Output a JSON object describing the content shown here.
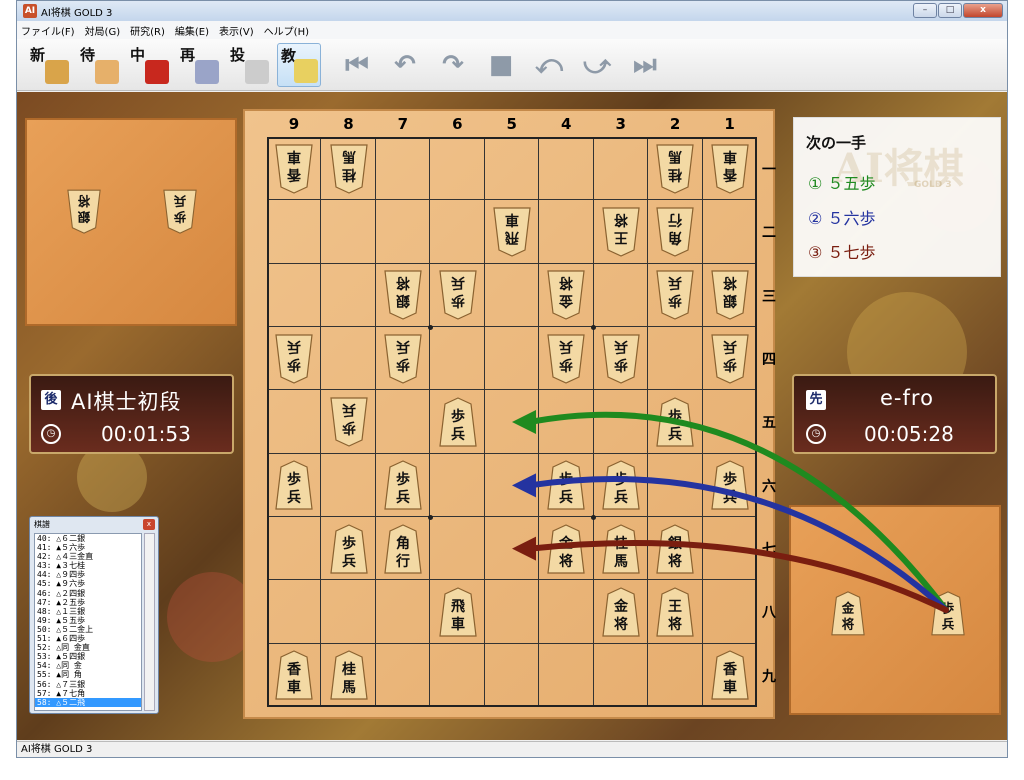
{
  "window": {
    "title": "AI将棋 GOLD 3",
    "app_icon": "AI",
    "minimize": "–",
    "maximize": "□",
    "close": "x"
  },
  "menu": [
    "ファイル(F)",
    "対局(G)",
    "研究(R)",
    "編集(E)",
    "表示(V)",
    "ヘルプ(H)"
  ],
  "toolbar": [
    {
      "label": "新",
      "icon": "new-game-icon",
      "color": "#d9a44a"
    },
    {
      "label": "待",
      "icon": "wait-hand-icon",
      "color": "#e6b06a"
    },
    {
      "label": "中",
      "icon": "stop-icon",
      "color": "#c8281e"
    },
    {
      "label": "再",
      "icon": "resume-icon",
      "color": "#9aa4c8"
    },
    {
      "label": "投",
      "icon": "resign-flag-icon",
      "color": "#cccccc"
    },
    {
      "label": "教",
      "icon": "teach-bulb-icon",
      "color": "#e8d060"
    }
  ],
  "nav_icons": [
    "first-move-icon",
    "undo-icon",
    "redo-icon",
    "stop-square-icon",
    "back-step-icon",
    "forward-step-icon",
    "last-move-icon"
  ],
  "nav_glyphs": [
    "⏮",
    "↶",
    "↷",
    "■",
    "⤺",
    "⤻",
    "⏭"
  ],
  "board": {
    "files": [
      "9",
      "8",
      "7",
      "6",
      "5",
      "4",
      "3",
      "2",
      "1"
    ],
    "ranks": [
      "一",
      "二",
      "三",
      "四",
      "五",
      "六",
      "七",
      "八",
      "九"
    ],
    "pieces": [
      {
        "file": 9,
        "rank": 1,
        "text": "香車",
        "side": "gote"
      },
      {
        "file": 8,
        "rank": 1,
        "text": "桂馬",
        "side": "gote"
      },
      {
        "file": 2,
        "rank": 1,
        "text": "桂馬",
        "side": "gote"
      },
      {
        "file": 1,
        "rank": 1,
        "text": "香車",
        "side": "gote"
      },
      {
        "file": 5,
        "rank": 2,
        "text": "飛車",
        "side": "gote"
      },
      {
        "file": 3,
        "rank": 2,
        "text": "王将",
        "side": "gote"
      },
      {
        "file": 2,
        "rank": 2,
        "text": "角行",
        "side": "gote"
      },
      {
        "file": 7,
        "rank": 3,
        "text": "銀将",
        "side": "gote"
      },
      {
        "file": 6,
        "rank": 3,
        "text": "歩兵",
        "side": "gote"
      },
      {
        "file": 4,
        "rank": 3,
        "text": "金将",
        "side": "gote"
      },
      {
        "file": 2,
        "rank": 3,
        "text": "歩兵",
        "side": "gote"
      },
      {
        "file": 1,
        "rank": 3,
        "text": "銀将",
        "side": "gote"
      },
      {
        "file": 9,
        "rank": 4,
        "text": "歩兵",
        "side": "gote"
      },
      {
        "file": 7,
        "rank": 4,
        "text": "歩兵",
        "side": "gote"
      },
      {
        "file": 4,
        "rank": 4,
        "text": "歩兵",
        "side": "gote"
      },
      {
        "file": 3,
        "rank": 4,
        "text": "歩兵",
        "side": "gote"
      },
      {
        "file": 1,
        "rank": 4,
        "text": "歩兵",
        "side": "gote"
      },
      {
        "file": 8,
        "rank": 5,
        "text": "歩兵",
        "side": "gote"
      },
      {
        "file": 6,
        "rank": 5,
        "text": "歩兵",
        "side": "sente"
      },
      {
        "file": 2,
        "rank": 5,
        "text": "歩兵",
        "side": "sente"
      },
      {
        "file": 9,
        "rank": 6,
        "text": "歩兵",
        "side": "sente"
      },
      {
        "file": 7,
        "rank": 6,
        "text": "歩兵",
        "side": "sente"
      },
      {
        "file": 4,
        "rank": 6,
        "text": "歩兵",
        "side": "sente"
      },
      {
        "file": 3,
        "rank": 6,
        "text": "歩兵",
        "side": "sente"
      },
      {
        "file": 1,
        "rank": 6,
        "text": "歩兵",
        "side": "sente"
      },
      {
        "file": 8,
        "rank": 7,
        "text": "歩兵",
        "side": "sente"
      },
      {
        "file": 7,
        "rank": 7,
        "text": "角行",
        "side": "sente"
      },
      {
        "file": 4,
        "rank": 7,
        "text": "金将",
        "side": "sente"
      },
      {
        "file": 3,
        "rank": 7,
        "text": "桂馬",
        "side": "sente"
      },
      {
        "file": 2,
        "rank": 7,
        "text": "銀将",
        "side": "sente"
      },
      {
        "file": 6,
        "rank": 8,
        "text": "飛車",
        "side": "sente"
      },
      {
        "file": 3,
        "rank": 8,
        "text": "金将",
        "side": "sente"
      },
      {
        "file": 2,
        "rank": 8,
        "text": "王将",
        "side": "sente"
      },
      {
        "file": 9,
        "rank": 9,
        "text": "香車",
        "side": "sente"
      },
      {
        "file": 8,
        "rank": 9,
        "text": "桂馬",
        "side": "sente"
      },
      {
        "file": 1,
        "rank": 9,
        "text": "香車",
        "side": "sente"
      }
    ]
  },
  "gote_hand": [
    "銀将",
    "歩兵"
  ],
  "sente_hand": [
    "金将",
    "歩兵"
  ],
  "gote_player": {
    "badge": "後",
    "name": "AI棋士初段",
    "time": "00:01:53"
  },
  "sente_player": {
    "badge": "先",
    "name": "e-fro",
    "time": "00:05:28"
  },
  "hints": {
    "title": "次の一手",
    "watermark": "AI将棋",
    "watermark_sub": "GOLD 3",
    "items": [
      {
        "num": "①",
        "move": "５五歩",
        "color": "#1f8a1f"
      },
      {
        "num": "②",
        "move": "５六歩",
        "color": "#2433a0"
      },
      {
        "num": "③",
        "move": "５七歩",
        "color": "#7a1e10"
      }
    ]
  },
  "kifu": {
    "title": "棋譜",
    "close": "x",
    "rows": [
      "40: △６二銀",
      "41: ▲５六歩",
      "42: △４三金直",
      "43: ▲３七桂",
      "44: △９四歩",
      "45: ▲９六歩",
      "46: △２四銀",
      "47: ▲２五歩",
      "48: △１三銀",
      "49: ▲５五歩",
      "50: △５二金上",
      "51: ▲６四歩",
      "52: △同 金直",
      "53: ▲５四銀",
      "54: △同 金",
      "55: ▲同 角",
      "56: △７三銀",
      "57: ▲７七角",
      "58: △５二飛"
    ],
    "selected_index": 18
  },
  "statusbar": "AI将棋 GOLD 3"
}
